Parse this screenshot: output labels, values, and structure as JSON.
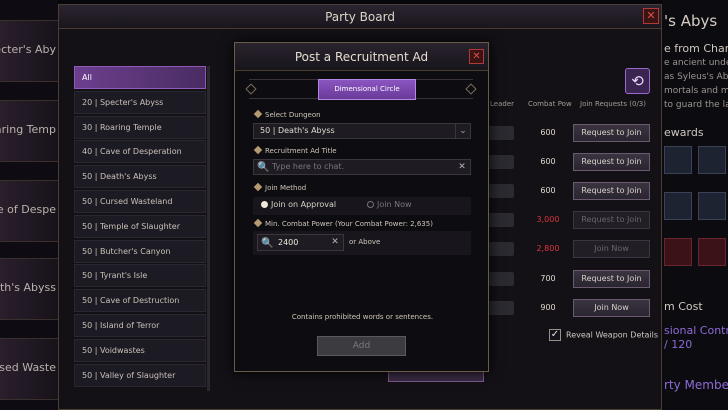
{
  "background": {
    "left_tiles": [
      "pecter's Aby",
      "oaring Temp",
      "ave of Despe",
      "eath's Abyss",
      "ursed Waste"
    ],
    "right_panel": {
      "title": "'s Abys",
      "line1": "e from Charac",
      "lines": [
        "e ancient underg",
        "as Syleus's Abys",
        "mortals and mons",
        "to guard the lab"
      ],
      "rewards": "ewards",
      "cost": "m Cost",
      "contract": "sional Contract",
      "contract_count": "/ 120",
      "members": "rty Members"
    }
  },
  "board": {
    "title": "Party Board",
    "close": "✕",
    "refresh_icon": "⟲",
    "list": [
      "All",
      "20 | Specter's Abyss",
      "30 | Roaring Temple",
      "40 | Cave of Desperation",
      "50 | Death's Abyss",
      "50 | Cursed Wasteland",
      "50 | Temple of Slaughter",
      "50 | Butcher's Canyon",
      "50 | Tyrant's Isle",
      "50 | Cave of Destruction",
      "50 | Island of Terror",
      "50 | Voidwastes",
      "50 | Valley of Slaughter"
    ],
    "columns": {
      "leader": "Leader",
      "combat_pow": "Combat Pow",
      "join_requests": "Join Requests (0/3)"
    },
    "rows": [
      {
        "cp": "600",
        "btn": "Request to Join",
        "cp_color": "#e0d8cc",
        "disabled": false
      },
      {
        "cp": "600",
        "btn": "Request to Join",
        "cp_color": "#e0d8cc",
        "disabled": false
      },
      {
        "cp": "600",
        "btn": "Request to Join",
        "cp_color": "#e0d8cc",
        "disabled": false
      },
      {
        "cp": "3,000",
        "btn": "Request to Join",
        "cp_color": "#d8383a",
        "disabled": true
      },
      {
        "cp": "2,800",
        "btn": "Join Now",
        "cp_color": "#d8383a",
        "disabled": true
      },
      {
        "cp": "700",
        "btn": "Request to Join",
        "cp_color": "#e0d8cc",
        "disabled": false
      },
      {
        "cp": "900",
        "btn": "Join Now",
        "cp_color": "#e0d8cc",
        "disabled": false
      }
    ],
    "reveal_weapon": "Reveal Weapon Details",
    "reveal_checked": "✓"
  },
  "dialog": {
    "title": "Post a Recruitment Ad",
    "close": "✕",
    "tab": "Dimensional Circle",
    "select_dungeon_label": "Select Dungeon",
    "dungeon_value": "50 | Death's Abyss",
    "dropdown_arrow": "⌄",
    "ad_title_label": "Recruitment Ad Title",
    "ad_title_placeholder": "Type here to chat.",
    "search_icon": "🔍",
    "clear_icon": "✕",
    "join_method_label": "Join Method",
    "join_on_approval": "Join on Approval",
    "join_now": "Join Now",
    "min_cp_label": "Min. Combat Power (Your Combat Power: 2,635)",
    "min_cp_value": "2400",
    "or_above": "or Above",
    "warning": "Contains prohibited words or sentences.",
    "add": "Add"
  }
}
